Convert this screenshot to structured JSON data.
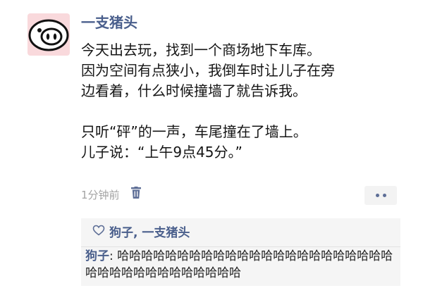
{
  "post": {
    "author": "一支猪头",
    "avatar_icon": "pig-face-icon",
    "lines": [
      "今天出去玩，找到一个商场地下车库。",
      "因为空间有点狭小，我倒车时让儿子在旁",
      "边看着，什么时候撞墙了就告诉我。",
      "只听“砰”的一声，车尾撞在了墙上。",
      "儿子说：“上午9点45分。”"
    ],
    "time": "1分钟前",
    "delete_icon": "trash-icon",
    "more_icon": "more-dots-icon"
  },
  "interactions": {
    "like_icon": "heart-outline-icon",
    "likes": "狗子, 一支猪头",
    "comment": {
      "author": "狗子",
      "separator": ": ",
      "text": "哈哈哈哈哈哈哈哈哈哈哈哈哈哈哈哈哈哈哈哈哈哈哈哈哈哈哈哈哈哈哈哈哈哈哈哈"
    }
  },
  "colors": {
    "name_link": "#4a5f8c",
    "avatar_bg": "#f9d9dc",
    "comment_bg": "#f5f5f5",
    "time_text": "#a3a3a3"
  }
}
